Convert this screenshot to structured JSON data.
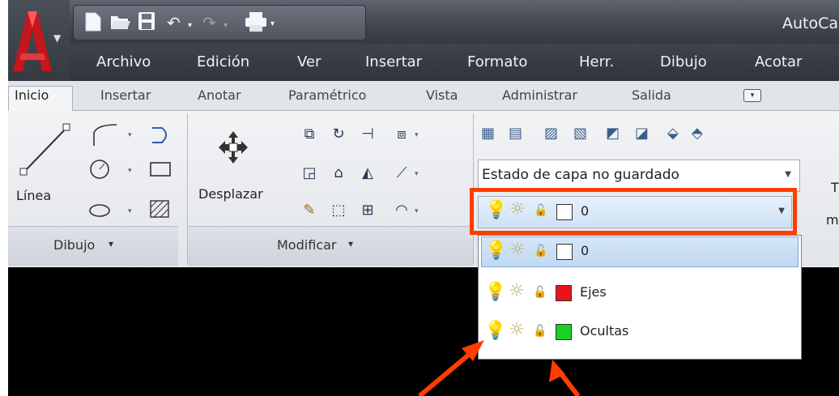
{
  "app": {
    "title": "AutoCa",
    "quick_access": [
      "new-icon",
      "open-icon",
      "save-icon",
      "undo-icon",
      "redo-icon",
      "plot-icon"
    ]
  },
  "menu": [
    "Archivo",
    "Edición",
    "Ver",
    "Insertar",
    "Formato",
    "Herr.",
    "Dibujo",
    "Acotar"
  ],
  "tabs": [
    "Inicio",
    "Insertar",
    "Anotar",
    "Paramétrico",
    "Vista",
    "Administrar",
    "Salida"
  ],
  "ribbon": {
    "linea_label": "Línea",
    "desplazar_label": "Desplazar",
    "dibujo_panel": "Dibujo",
    "modificar_panel": "Modificar",
    "panel_arrow": "▾",
    "layer_state": "Estado de capa no guardado",
    "current_layer": "0",
    "cut_text_1": "T",
    "cut_text_2": "m"
  },
  "layers": [
    {
      "name": "0",
      "color": "#ffffff",
      "selected": true
    },
    {
      "name": "Ejes",
      "color": "#e8141c",
      "selected": false
    },
    {
      "name": "Ocultas",
      "color": "#19d024",
      "selected": false
    }
  ],
  "colors": {
    "highlight_box": "#ff3d00",
    "arrow": "#ff3d00",
    "selected_row": "#c6dcf2"
  }
}
